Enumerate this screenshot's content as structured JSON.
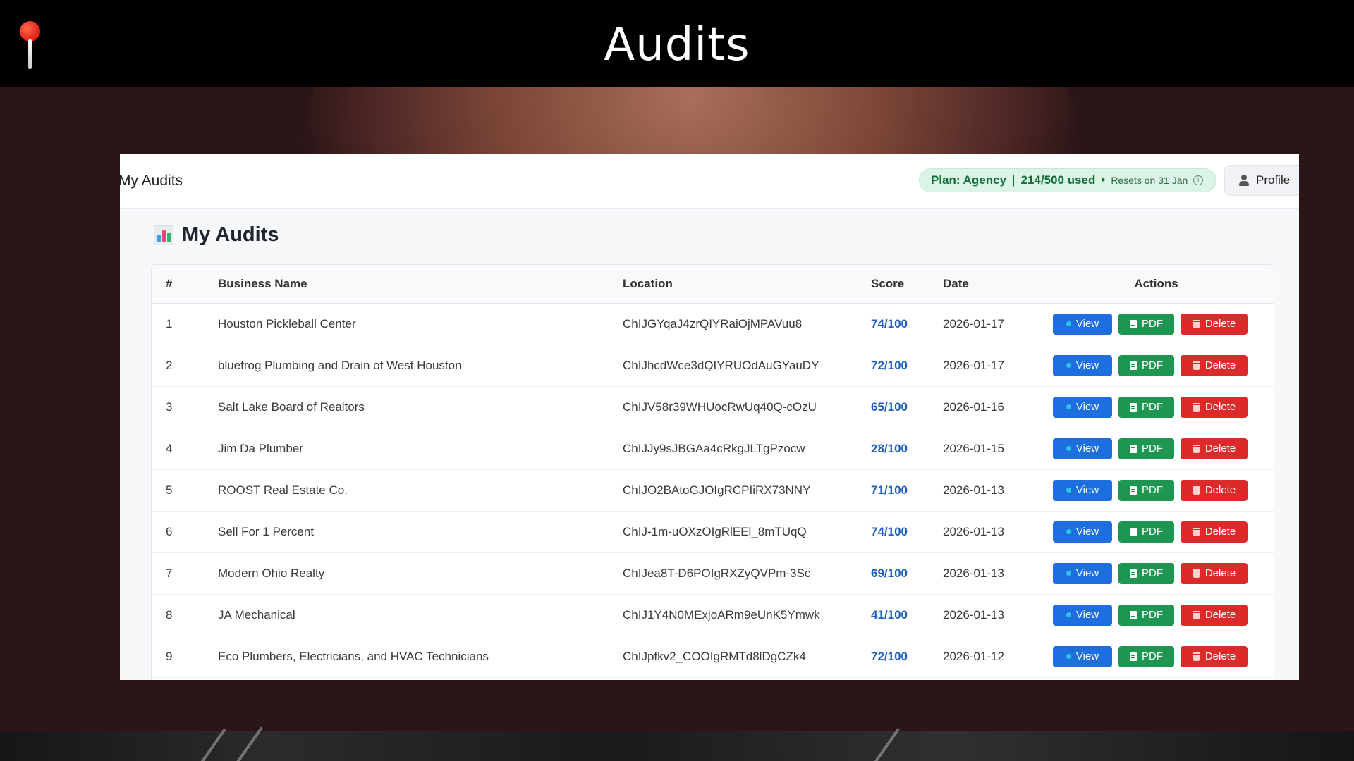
{
  "window": {
    "title": "Audits"
  },
  "appbar": {
    "title": "My Audits",
    "plan": {
      "label": "Plan: Agency",
      "separator": "|",
      "usage": "214/500 used",
      "bullet": "•",
      "resets": "Resets on 31 Jan",
      "info_icon": "info-icon"
    },
    "profile": {
      "label": "Profile",
      "icon": "person-icon"
    }
  },
  "section": {
    "title": "My Audits",
    "icon": "bar-chart-icon"
  },
  "table": {
    "headers": [
      "#",
      "Business Name",
      "Location",
      "Score",
      "Date",
      "Actions"
    ],
    "action_labels": {
      "view": "View",
      "pdf": "PDF",
      "delete": "Delete"
    },
    "rows": [
      {
        "num": "1",
        "name": "Houston Pickleball Center",
        "location": "ChIJGYqaJ4zrQIYRaiOjMPAVuu8",
        "score": "74/100",
        "date": "2026-01-17"
      },
      {
        "num": "2",
        "name": "bluefrog Plumbing and Drain of West Houston",
        "location": "ChIJhcdWce3dQIYRUOdAuGYauDY",
        "score": "72/100",
        "date": "2026-01-17"
      },
      {
        "num": "3",
        "name": "Salt Lake Board of Realtors",
        "location": "ChIJV58r39WHUocRwUq40Q-cOzU",
        "score": "65/100",
        "date": "2026-01-16"
      },
      {
        "num": "4",
        "name": "Jim Da Plumber",
        "location": "ChIJJy9sJBGAa4cRkgJLTgPzocw",
        "score": "28/100",
        "date": "2026-01-15"
      },
      {
        "num": "5",
        "name": "ROOST Real Estate Co.",
        "location": "ChIJO2BAtoGJOIgRCPIiRX73NNY",
        "score": "71/100",
        "date": "2026-01-13"
      },
      {
        "num": "6",
        "name": "Sell For 1 Percent",
        "location": "ChIJ-1m-uOXzOIgRlEEl_8mTUqQ",
        "score": "74/100",
        "date": "2026-01-13"
      },
      {
        "num": "7",
        "name": "Modern Ohio Realty",
        "location": "ChIJea8T-D6POIgRXZyQVPm-3Sc",
        "score": "69/100",
        "date": "2026-01-13"
      },
      {
        "num": "8",
        "name": "JA Mechanical",
        "location": "ChIJ1Y4N0MExjoARm9eUnK5Ymwk",
        "score": "41/100",
        "date": "2026-01-13"
      },
      {
        "num": "9",
        "name": "Eco Plumbers, Electricians, and HVAC Technicians",
        "location": "ChIJpfkv2_COOIgRMTd8lDgCZk4",
        "score": "72/100",
        "date": "2026-01-12"
      }
    ]
  },
  "colors": {
    "view": "#1d6fe0",
    "pdf": "#1e9550",
    "delete": "#dc2a2a",
    "score": "#1f5fbf",
    "plan_pill_bg": "#dcf4e6"
  }
}
